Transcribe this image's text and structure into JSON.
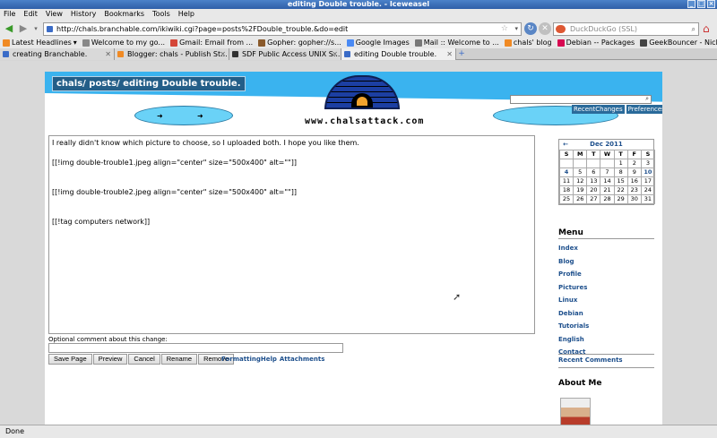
{
  "window": {
    "title": "editing Double trouble. - Iceweasel"
  },
  "menubar": [
    "File",
    "Edit",
    "View",
    "History",
    "Bookmarks",
    "Tools",
    "Help"
  ],
  "navbar": {
    "url": "http://chals.branchable.com/ikiwiki.cgi?page=posts%2FDouble_trouble.&do=edit",
    "search_placeholder": "DuckDuckGo (SSL)"
  },
  "bookmarks": [
    {
      "label": "Latest Headlines",
      "color": "#f08a24"
    },
    {
      "label": "Welcome to my go...",
      "color": "#888888"
    },
    {
      "label": "Gmail: Email from ...",
      "color": "#d44638"
    },
    {
      "label": "Gopher: gopher://s...",
      "color": "#8a5a2b"
    },
    {
      "label": "Google Images",
      "color": "#4a8af4"
    },
    {
      "label": "Mail :: Welcome to ...",
      "color": "#777777"
    },
    {
      "label": "chals' blog",
      "color": "#f08a24"
    },
    {
      "label": "Debian -- Packages",
      "color": "#d70751"
    },
    {
      "label": "GeekBouncer - Nick...",
      "color": "#444444"
    }
  ],
  "tabs": [
    {
      "label": "creating Branchable.",
      "color": "#3b6cc7",
      "active": false
    },
    {
      "label": "Blogger: chals - Publish St...",
      "color": "#f08a24",
      "active": false
    },
    {
      "label": "SDF Public Access UNIX S...",
      "color": "#333333",
      "active": false
    },
    {
      "label": "editing Double trouble.",
      "color": "#3b6cc7",
      "active": true
    }
  ],
  "banner": {
    "breadcrumb": "chals/ posts/   editing Double trouble.",
    "site_name": "www.chalsattack.com",
    "actions": [
      "RecentChanges",
      "Preferences"
    ]
  },
  "editor": {
    "lines": [
      "I really didn't know which picture to choose, so I uploaded both. I hope you like them.",
      "",
      "[[!img double-trouble1.jpeg align=\"center\" size=\"500x400\" alt=\"\"]]",
      "",
      "",
      "[[!img double-trouble2.jpeg align=\"center\" size=\"500x400\" alt=\"\"]]",
      "",
      "",
      "[[!tag computers network]]"
    ],
    "comment_label": "Optional comment about this change:",
    "buttons": [
      "Save Page",
      "Preview",
      "Cancel",
      "Rename",
      "Remove"
    ],
    "links": [
      "FormattingHelp",
      "Attachments"
    ]
  },
  "calendar": {
    "prev": "←",
    "month": "Dec 2011",
    "dow": [
      "S",
      "M",
      "T",
      "W",
      "T",
      "F",
      "S"
    ],
    "weeks": [
      [
        "",
        "",
        "",
        "",
        "1",
        "2",
        "3"
      ],
      [
        "4",
        "5",
        "6",
        "7",
        "8",
        "9",
        "10"
      ],
      [
        "11",
        "12",
        "13",
        "14",
        "15",
        "16",
        "17"
      ],
      [
        "18",
        "19",
        "20",
        "21",
        "22",
        "23",
        "24"
      ],
      [
        "25",
        "26",
        "27",
        "28",
        "29",
        "30",
        "31"
      ]
    ],
    "linked_days": [
      "4",
      "10"
    ]
  },
  "sidebar": {
    "menu_heading": "Menu",
    "menu": [
      "Index",
      "Blog",
      "Profile",
      "Pictures",
      "Linux",
      "Debian",
      "Tutorials",
      "English",
      "Contact"
    ],
    "recent_comments": "Recent Comments",
    "about_me": "About Me"
  },
  "statusbar": {
    "text": "Done"
  }
}
